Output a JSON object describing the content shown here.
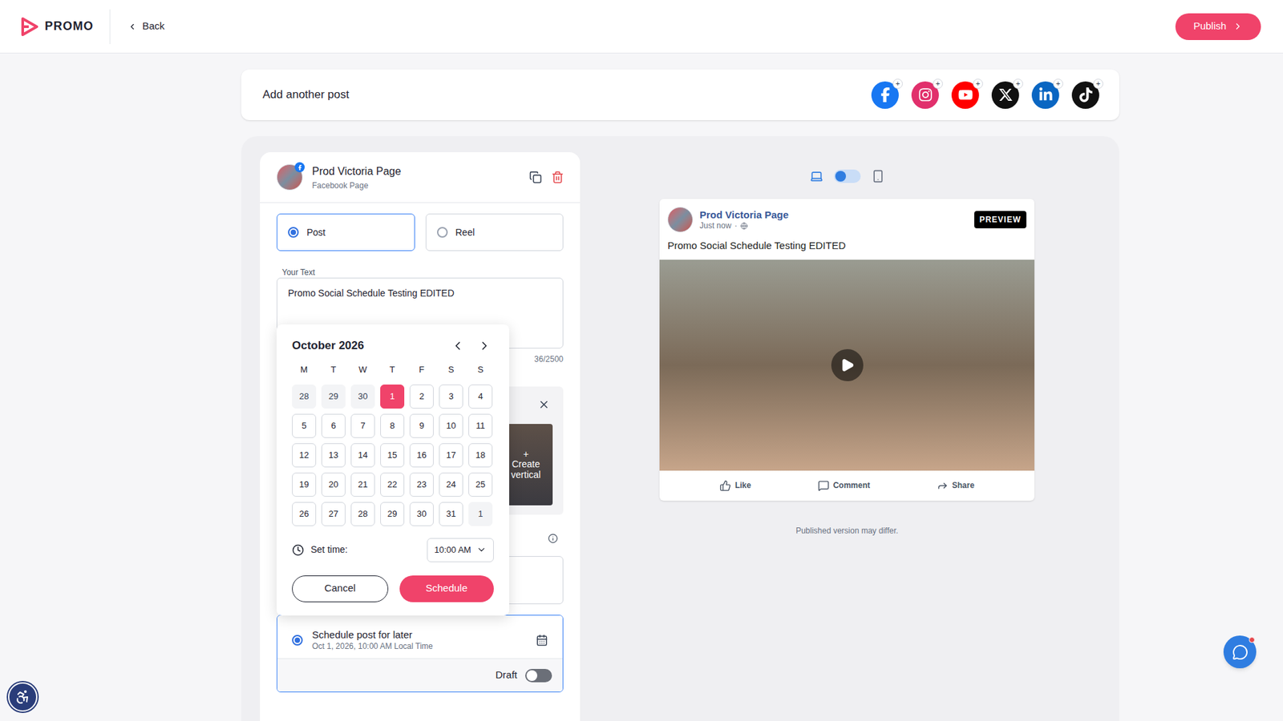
{
  "header": {
    "logo": "PROMO",
    "back": "Back",
    "publish": "Publish"
  },
  "add_post": {
    "label": "Add another post",
    "networks": [
      {
        "kind": "facebook",
        "badge": "+"
      },
      {
        "kind": "instagram",
        "badge": "+"
      },
      {
        "kind": "youtube",
        "badge": "+"
      },
      {
        "kind": "x",
        "badge": "+"
      },
      {
        "kind": "linkedin",
        "badge": "+"
      },
      {
        "kind": "tiktok",
        "badge": "+"
      }
    ]
  },
  "post": {
    "account": {
      "name": "Prod Victoria Page",
      "type": "Facebook Page"
    },
    "formats": [
      {
        "label": "Post",
        "selected": true
      },
      {
        "label": "Reel",
        "selected": false
      }
    ],
    "text_label": "Your Text",
    "text": "Promo Social Schedule Testing EDITED",
    "counter": "36/2500",
    "media": {
      "create_vertical": {
        "icon": "+",
        "label": "Create vertical"
      }
    },
    "schedule": {
      "selected": true,
      "label": "Schedule post for later",
      "value": "Oct 1, 2026, 10:00 AM Local Time"
    },
    "draft": {
      "label": "Draft",
      "on": false
    }
  },
  "calendar": {
    "month": "October 2026",
    "weekdays": [
      "M",
      "T",
      "W",
      "T",
      "F",
      "S",
      "S"
    ],
    "days": [
      {
        "label": "28",
        "outside": true,
        "selected": false
      },
      {
        "label": "29",
        "outside": true,
        "selected": false
      },
      {
        "label": "30",
        "outside": true,
        "selected": false
      },
      {
        "label": "1",
        "outside": false,
        "selected": true
      },
      {
        "label": "2",
        "outside": false,
        "selected": false
      },
      {
        "label": "3",
        "outside": false,
        "selected": false
      },
      {
        "label": "4",
        "outside": false,
        "selected": false
      },
      {
        "label": "5",
        "outside": false,
        "selected": false
      },
      {
        "label": "6",
        "outside": false,
        "selected": false
      },
      {
        "label": "7",
        "outside": false,
        "selected": false
      },
      {
        "label": "8",
        "outside": false,
        "selected": false
      },
      {
        "label": "9",
        "outside": false,
        "selected": false
      },
      {
        "label": "10",
        "outside": false,
        "selected": false
      },
      {
        "label": "11",
        "outside": false,
        "selected": false
      },
      {
        "label": "12",
        "outside": false,
        "selected": false
      },
      {
        "label": "13",
        "outside": false,
        "selected": false
      },
      {
        "label": "14",
        "outside": false,
        "selected": false
      },
      {
        "label": "15",
        "outside": false,
        "selected": false
      },
      {
        "label": "16",
        "outside": false,
        "selected": false
      },
      {
        "label": "17",
        "outside": false,
        "selected": false
      },
      {
        "label": "18",
        "outside": false,
        "selected": false
      },
      {
        "label": "19",
        "outside": false,
        "selected": false
      },
      {
        "label": "20",
        "outside": false,
        "selected": false
      },
      {
        "label": "21",
        "outside": false,
        "selected": false
      },
      {
        "label": "22",
        "outside": false,
        "selected": false
      },
      {
        "label": "23",
        "outside": false,
        "selected": false
      },
      {
        "label": "24",
        "outside": false,
        "selected": false
      },
      {
        "label": "25",
        "outside": false,
        "selected": false
      },
      {
        "label": "26",
        "outside": false,
        "selected": false
      },
      {
        "label": "27",
        "outside": false,
        "selected": false
      },
      {
        "label": "28",
        "outside": false,
        "selected": false
      },
      {
        "label": "29",
        "outside": false,
        "selected": false
      },
      {
        "label": "30",
        "outside": false,
        "selected": false
      },
      {
        "label": "31",
        "outside": false,
        "selected": false
      },
      {
        "label": "1",
        "outside": true,
        "selected": false
      }
    ],
    "time_label": "Set time:",
    "time": "10:00 AM",
    "cancel": "Cancel",
    "schedule": "Schedule"
  },
  "preview": {
    "mobile": false,
    "name": "Prod Victoria Page",
    "time": "Just now",
    "separator": "·",
    "badge": "PREVIEW",
    "text": "Promo Social Schedule Testing EDITED",
    "actions": [
      "Like",
      "Comment",
      "Share"
    ],
    "note": "Published version may differ."
  }
}
